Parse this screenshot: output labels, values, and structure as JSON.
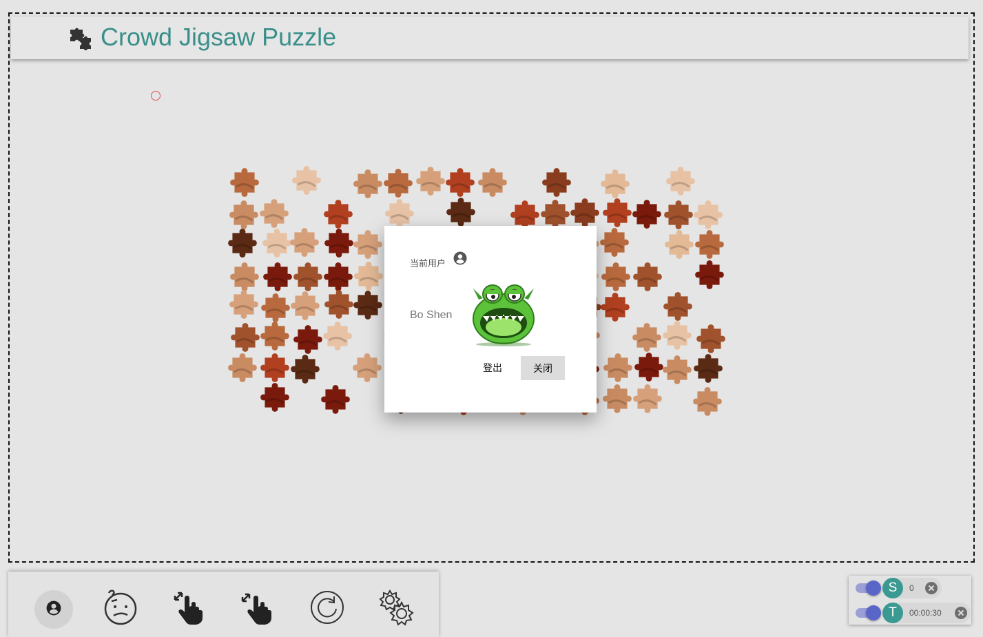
{
  "header": {
    "title": "Crowd Jigsaw Puzzle",
    "logo_icon": "puzzle-pieces-icon",
    "title_color": "#3a8f8a"
  },
  "puzzle": {
    "colors": [
      "#d6a07a",
      "#b86a3e",
      "#8a3c1e",
      "#e3b996",
      "#7a1a0c",
      "#a0522d",
      "#c98b62",
      "#5a2a14",
      "#e8c2a4",
      "#b0401f"
    ]
  },
  "dialog": {
    "user_label": "当前用户",
    "user_label_icon": "account-circle-icon",
    "user_name": "Bo Shen",
    "avatar": "green-monster-avatar",
    "logout_label": "登出",
    "close_label": "关闭"
  },
  "toolbar": {
    "tools": [
      {
        "name": "profile-tool",
        "icon": "account-circle-icon",
        "active": true
      },
      {
        "name": "hint-tool",
        "icon": "confused-face-icon",
        "active": false
      },
      {
        "name": "zoom-in-tool",
        "icon": "expand-hand-icon",
        "active": false
      },
      {
        "name": "zoom-out-tool",
        "icon": "shrink-hand-icon",
        "active": false
      },
      {
        "name": "restart-tool",
        "icon": "restart-icon",
        "active": false
      },
      {
        "name": "settings-tool",
        "icon": "gears-icon",
        "active": false
      }
    ]
  },
  "status": {
    "score_avatar": "S",
    "score_value": "0",
    "timer_avatar": "T",
    "timer_value": "00:00:30",
    "accent": "#3a9a91",
    "toggle_color": "#5a66c7"
  }
}
